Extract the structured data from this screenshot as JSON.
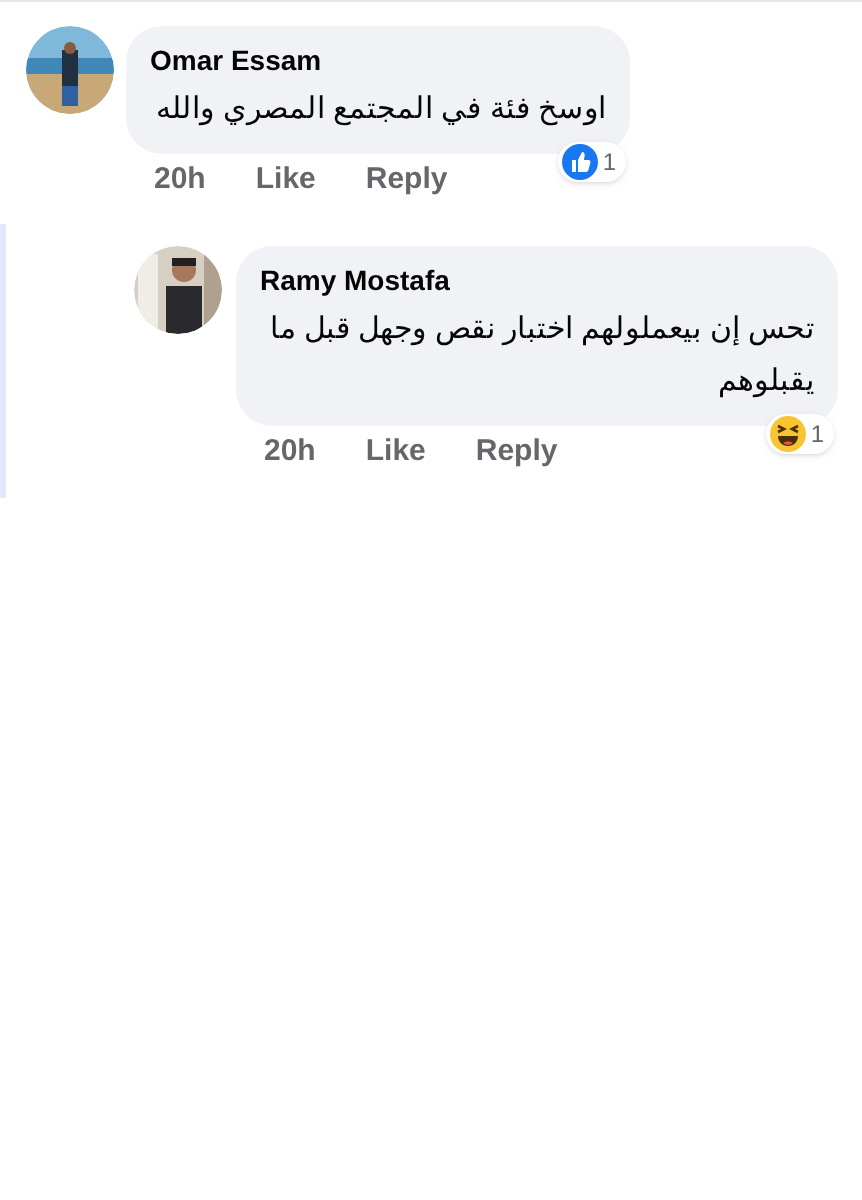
{
  "comments": [
    {
      "author": "Omar Essam",
      "text": "اوسخ فئة في المجتمع المصري والله",
      "time": "20h",
      "like": "Like",
      "reply": "Reply",
      "reaction": {
        "kind": "like",
        "count": "1"
      },
      "is_reply": false
    },
    {
      "author": "Ramy Mostafa",
      "text": "تحس إن بيعملولهم اختبار نقص وجهل قبل ما يقبلوهم",
      "time": "20h",
      "like": "Like",
      "reply": "Reply",
      "reaction": {
        "kind": "haha",
        "count": "1"
      },
      "is_reply": true
    }
  ]
}
